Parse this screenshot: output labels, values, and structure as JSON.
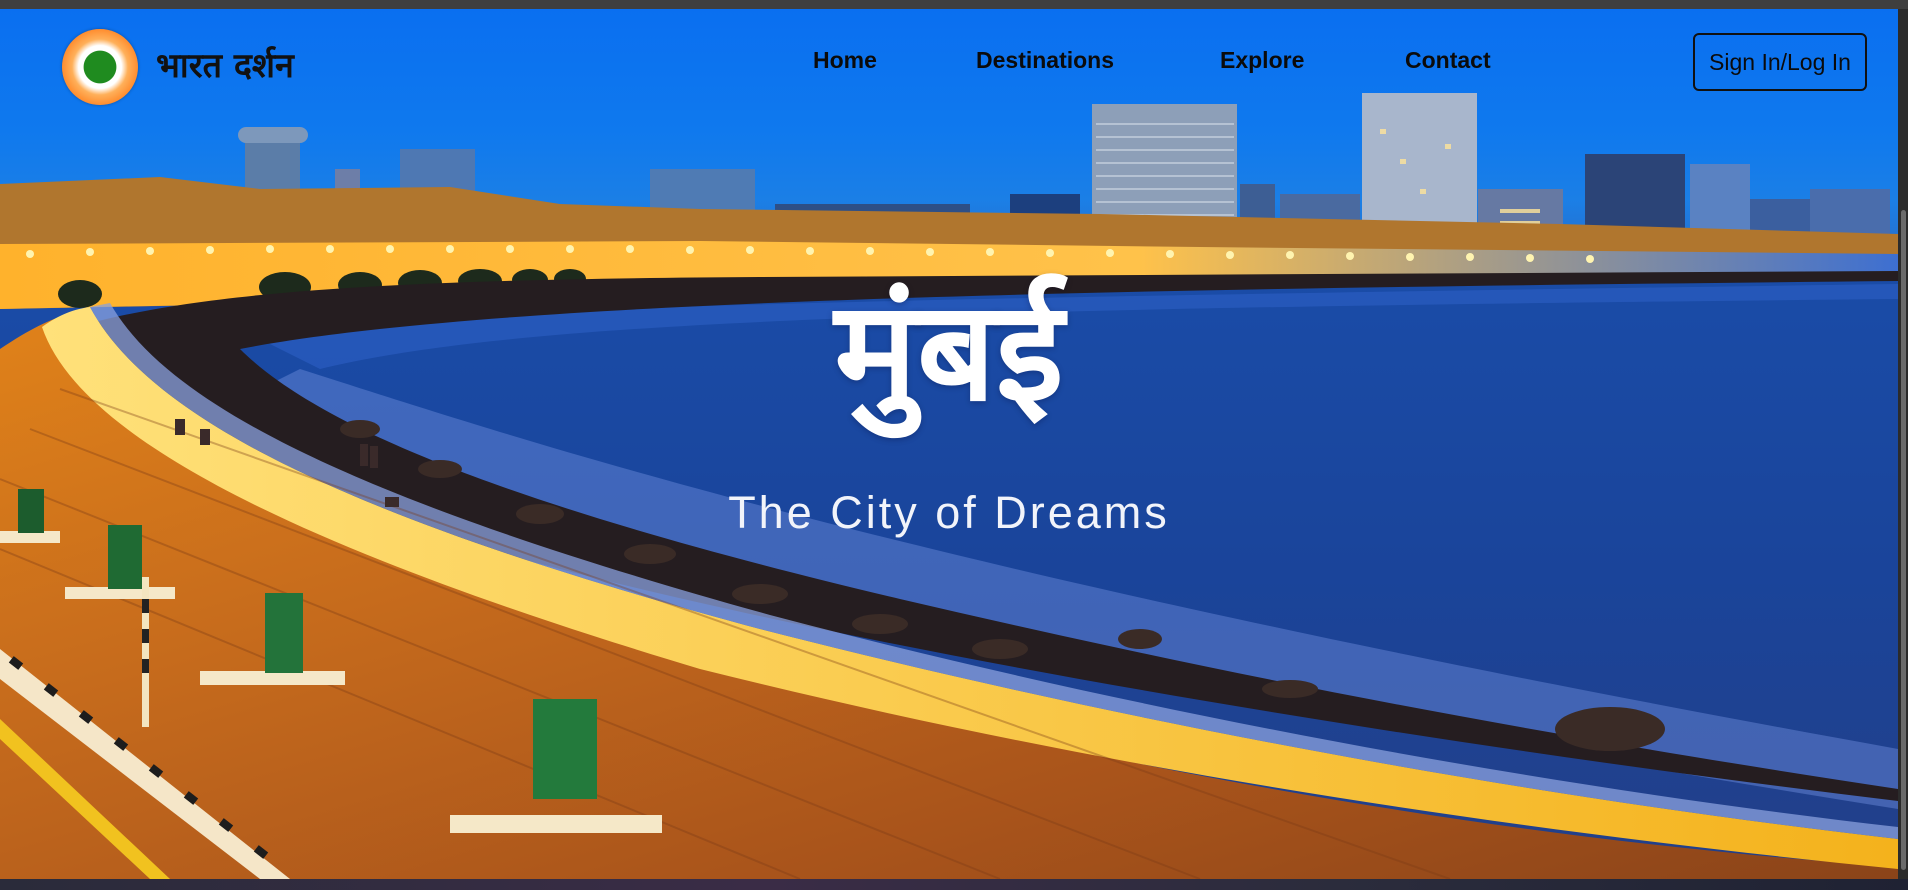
{
  "header": {
    "brand_name": "भारत दर्शन",
    "logo_icon": "tricolor-circle-logo",
    "nav_links": [
      {
        "label": "Home"
      },
      {
        "label": "Destinations"
      },
      {
        "label": "Explore"
      },
      {
        "label": "Contact"
      }
    ],
    "signin_label": "Sign In/Log In"
  },
  "hero": {
    "title": "मुंबई",
    "subtitle": "The City of Dreams",
    "image_subject": "marine-drive-night-skyline"
  },
  "colors": {
    "sky": "#0a6ff0",
    "sea": "#1d4595",
    "promenade_light": "#f2a21a",
    "logo_saffron": "#f7852c",
    "logo_green": "#1f8b1f"
  }
}
